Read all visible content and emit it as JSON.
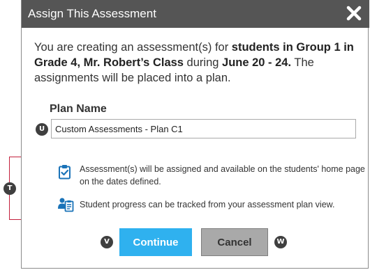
{
  "dialog": {
    "title": "Assign This Assessment",
    "intro": {
      "t1": "You are creating an assessment(s) for ",
      "b1": "students in Group 1 in Grade 4, Mr. Robert’s Class",
      "t2": " during ",
      "b2": "June 20 - 24.",
      "t3": " The assignments will be placed into a plan."
    },
    "plan_name_label": "Plan Name",
    "plan_name_value": "Custom Assessments - Plan C1",
    "info_items": [
      {
        "icon": "clipboard-check-icon",
        "text": "Assessment(s) will be assigned and available on the students' home page on the dates defined."
      },
      {
        "icon": "student-progress-icon",
        "text": "Student progress can be tracked from your assessment plan view."
      }
    ],
    "continue_label": "Continue",
    "cancel_label": "Cancel"
  },
  "annotations": {
    "u": "U",
    "t": "T",
    "v": "V",
    "w": "W"
  },
  "colors": {
    "titlebar": "#555555",
    "continue": "#2fb1ef",
    "cancel": "#a9a9a9",
    "icon": "#1a73b8",
    "bracket": "#c3203d"
  }
}
